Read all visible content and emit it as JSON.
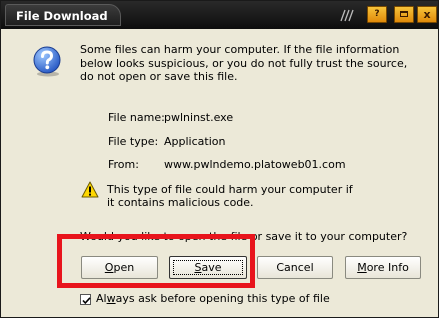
{
  "window": {
    "title": "File Download"
  },
  "titlebar_buttons": {
    "help": "?",
    "close": "x"
  },
  "message": {
    "warning": "Some files can harm your computer. If the file information below looks suspicious, or you do not fully trust the source, do not open or save this file."
  },
  "file_info": {
    "name_label": "File name:",
    "name_value": "pwlninst.exe",
    "type_label": "File type:",
    "type_value": "Application",
    "from_label": "From:",
    "from_value": "www.pwlndemo.platoweb01.com"
  },
  "danger": {
    "text": "This type of file could harm your computer if it contains malicious code."
  },
  "prompt": {
    "question": "Would you like to open the file or save it to your computer?"
  },
  "buttons": {
    "open": {
      "mnemonic": "O",
      "rest": "pen"
    },
    "save": {
      "mnemonic": "S",
      "rest": "ave"
    },
    "cancel": {
      "label": "Cancel"
    },
    "more_info": {
      "mnemonic": "M",
      "rest": "ore Info"
    }
  },
  "checkbox": {
    "checked": true,
    "mnemonic": "w",
    "prefix": "Al",
    "rest": "ays ask before opening this type of file"
  },
  "annotation": {
    "highlight_color": "#e8141c"
  }
}
